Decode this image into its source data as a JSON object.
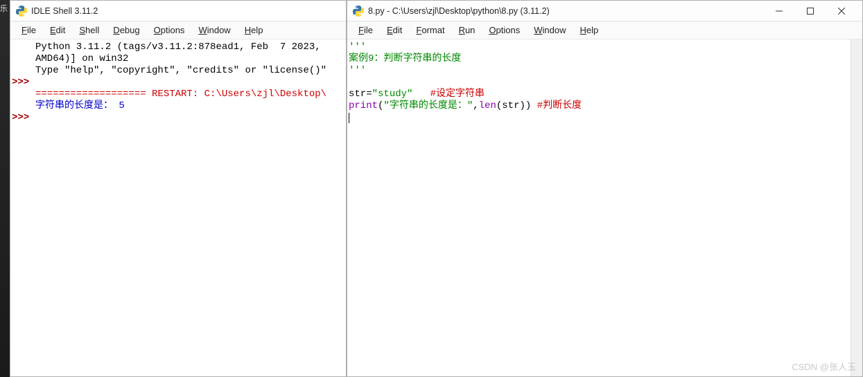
{
  "desktop_edge": "乐",
  "shell": {
    "title": "IDLE Shell 3.11.2",
    "menu": [
      "File",
      "Edit",
      "Shell",
      "Debug",
      "Options",
      "Window",
      "Help"
    ],
    "lines": [
      {
        "prompt": "",
        "segments": [
          {
            "t": "Python 3.11.2 (tags/v3.11.2:878ead1, Feb  7 2023,",
            "cls": ""
          }
        ]
      },
      {
        "prompt": "",
        "segments": [
          {
            "t": "AMD64)] on win32",
            "cls": ""
          }
        ]
      },
      {
        "prompt": "",
        "segments": [
          {
            "t": "Type \"help\", \"copyright\", \"credits\" or \"license()\"",
            "cls": ""
          }
        ]
      },
      {
        "prompt": ">>>",
        "segments": [
          {
            "t": "",
            "cls": ""
          }
        ]
      },
      {
        "prompt": "",
        "segments": [
          {
            "t": "=================== RESTART: C:\\Users\\zjl\\Desktop\\",
            "cls": "c-red"
          }
        ]
      },
      {
        "prompt": "",
        "segments": [
          {
            "t": "字符串的长度是： 5",
            "cls": "c-blue"
          }
        ]
      },
      {
        "prompt": ">>>",
        "segments": [
          {
            "t": "",
            "cls": ""
          }
        ]
      }
    ]
  },
  "editor": {
    "title": "8.py - C:\\Users\\zjl\\Desktop\\python\\8.py (3.11.2)",
    "menu": [
      "File",
      "Edit",
      "Format",
      "Run",
      "Options",
      "Window",
      "Help"
    ],
    "lines": [
      {
        "segments": [
          {
            "t": "'''",
            "cls": "c-green"
          }
        ]
      },
      {
        "segments": [
          {
            "t": "案例9：判断字符串的长度",
            "cls": "c-green"
          }
        ]
      },
      {
        "segments": [
          {
            "t": "'''",
            "cls": "c-green"
          }
        ]
      },
      {
        "segments": [
          {
            "t": "",
            "cls": ""
          }
        ]
      },
      {
        "segments": [
          {
            "t": "str",
            "cls": ""
          },
          {
            "t": "=",
            "cls": ""
          },
          {
            "t": "\"study\"",
            "cls": "c-green"
          },
          {
            "t": "   ",
            "cls": ""
          },
          {
            "t": "#设定字符串",
            "cls": "c-red"
          }
        ]
      },
      {
        "segments": [
          {
            "t": "print",
            "cls": "c-purple"
          },
          {
            "t": "(",
            "cls": ""
          },
          {
            "t": "\"字符串的长度是：\"",
            "cls": "c-green"
          },
          {
            "t": ",",
            "cls": ""
          },
          {
            "t": "len",
            "cls": "c-purple"
          },
          {
            "t": "(",
            "cls": ""
          },
          {
            "t": "str",
            "cls": ""
          },
          {
            "t": ")) ",
            "cls": ""
          },
          {
            "t": "#判断长度",
            "cls": "c-red"
          }
        ]
      }
    ]
  },
  "watermark": "CSDN @张人玉",
  "win_controls": {
    "min": "minimize",
    "max": "maximize",
    "close": "close"
  }
}
